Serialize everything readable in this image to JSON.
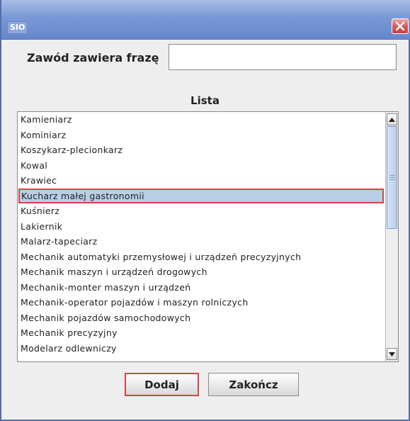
{
  "window": {
    "title": "SIO",
    "close_icon": "close-icon"
  },
  "search": {
    "label": "Zawód zawiera frazę",
    "value": "",
    "placeholder": ""
  },
  "list": {
    "heading": "Lista",
    "items": [
      "Kamieniarz",
      "Kominiarz",
      "Koszykarz-plecionkarz",
      "Kowal",
      "Krawiec",
      "Kucharz małej gastronomii",
      "Kuśnierz",
      "Lakiernik",
      "Malarz-tapeciarz",
      "Mechanik automatyki przemysłowej i urządzeń precyzyjnych",
      "Mechanik maszyn i urządzeń drogowych",
      "Mechanik-monter maszyn i urządzeń",
      "Mechanik-operator pojazdów i maszyn rolniczych",
      "Mechanik pojazdów samochodowych",
      "Mechanik precyzyjny",
      "Modelarz odlewniczy"
    ],
    "selected_index": 5
  },
  "scrollbar": {
    "up_icon": "arrow-up-icon",
    "down_icon": "arrow-down-icon"
  },
  "buttons": {
    "add_label": "Dodaj",
    "close_label": "Zakończ"
  },
  "colors": {
    "selection_bg": "#b8cfe5",
    "focus_border": "#d44545",
    "titlebar": "#7a98d6"
  }
}
